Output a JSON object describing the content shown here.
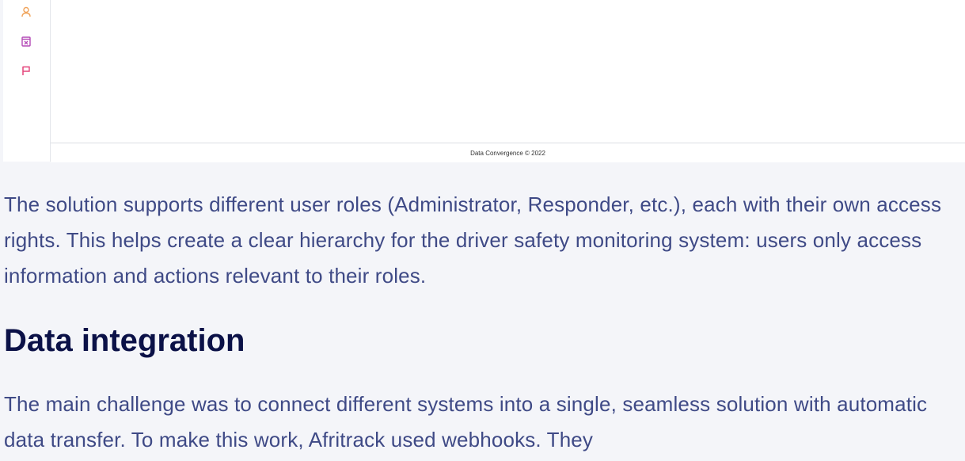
{
  "app_screenshot": {
    "nav_icons": [
      "user-icon",
      "calendar-x-icon",
      "flag-icon"
    ],
    "icon_colors": {
      "user": "#f0a35a",
      "calendar": "#b44bb7",
      "flag": "#e4457a"
    },
    "footer_text": "Data Convergence © 2022"
  },
  "article": {
    "paragraph_1": "The solution supports different user roles (Administrator, Responder, etc.), each with their own access rights. This helps create a clear hierarchy for the driver safety monitoring system: users only access information and actions relevant to their roles.",
    "heading": "Data integration",
    "paragraph_2": "The main challenge was to connect different systems into a single, seamless solution with automatic data transfer. To make this work, Afritrack used webhooks. They"
  }
}
